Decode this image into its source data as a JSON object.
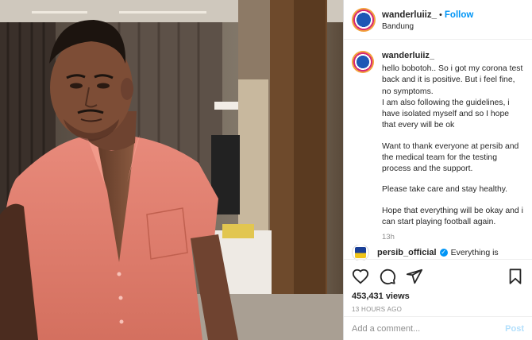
{
  "header": {
    "username": "wanderluiiz_",
    "separator": "•",
    "follow_label": "Follow",
    "location": "Bandung"
  },
  "caption": {
    "username": "wanderluiiz_",
    "paragraphs": [
      "hello bobotoh.. So i got my corona test back and it is positive. But i feel fine, no symptoms.",
      "I am also following the guidelines, i have isolated myself and so I hope that every will be ok",
      "Want to thank everyone at persib and the medical team for the testing process and the support.",
      "Please take care and stay healthy.",
      "Hope that everything will be okay and i can start playing football again."
    ],
    "time": "13h"
  },
  "comment": {
    "username": "persib_official",
    "text": "Everything is"
  },
  "actions": {
    "views": "453,431 views",
    "posted_ago": "13 HOURS AGO"
  },
  "add_comment": {
    "placeholder": "Add a comment...",
    "post_label": "Post"
  },
  "icons": {
    "like": "heart-icon",
    "comment": "comment-icon",
    "share": "share-icon",
    "save": "bookmark-icon"
  },
  "colors": {
    "follow": "#0095f6",
    "post_disabled": "#b2dffc",
    "muted": "#8e8e8e",
    "avatar_ring": "#d62976"
  }
}
